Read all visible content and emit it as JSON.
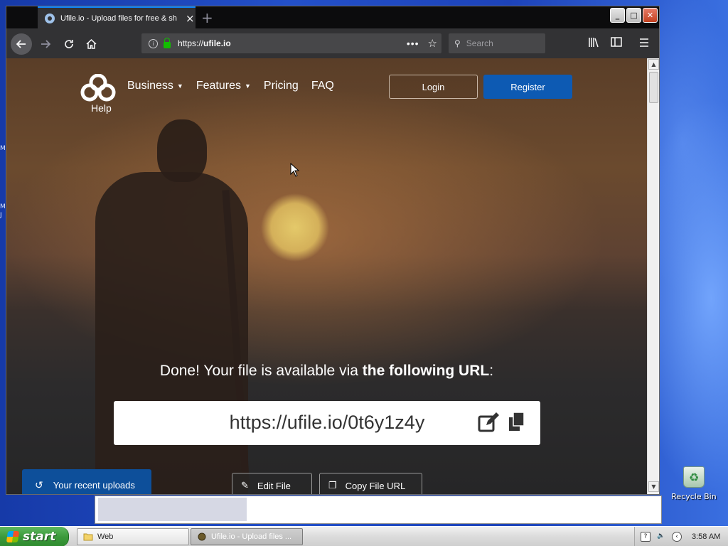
{
  "desktop": {
    "edge_text_1": "M",
    "edge_text_2": "M",
    "edge_text_3": "J",
    "recycle_bin_label": "Recycle Bin"
  },
  "browser": {
    "tab_title": "Ufile.io - Upload files for free & sh",
    "tab_close": "×",
    "new_tab": "+",
    "url_prefix": "https://",
    "url_domain": "ufile.io",
    "search_placeholder": "Search",
    "controls": {
      "minimize": "_",
      "maximize": "□",
      "close": "✕"
    }
  },
  "page": {
    "logo_help": "Help",
    "menu": [
      {
        "label": "Business",
        "has_caret": true
      },
      {
        "label": "Features",
        "has_caret": true
      },
      {
        "label": "Pricing",
        "has_caret": false
      },
      {
        "label": "FAQ",
        "has_caret": false
      }
    ],
    "login_label": "Login",
    "register_label": "Register",
    "done_prefix": "Done! Your file is available via ",
    "done_bold": "the following URL",
    "done_suffix": ":",
    "file_url": "https://ufile.io/0t6y1z4y",
    "recent_uploads_label": "Your recent uploads",
    "edit_file_label": "Edit File",
    "copy_file_url_label": "Copy File URL"
  },
  "taskbar": {
    "start_label": "start",
    "items": [
      {
        "label": "Web",
        "active": false
      },
      {
        "label": "Ufile.io - Upload files ...",
        "active": true
      }
    ],
    "clock": "3:58 AM"
  },
  "colors": {
    "register_blue": "#0d5ab3",
    "recent_blue": "#0d4f9a",
    "tab_accent": "#0a84ff",
    "lock_green": "#12bc00"
  },
  "icons": {
    "logo": "ufile-logo-icon",
    "edit": "edit-icon",
    "copy": "copy-icon",
    "history": "history-icon",
    "lock": "lock-icon",
    "star": "star-icon"
  }
}
